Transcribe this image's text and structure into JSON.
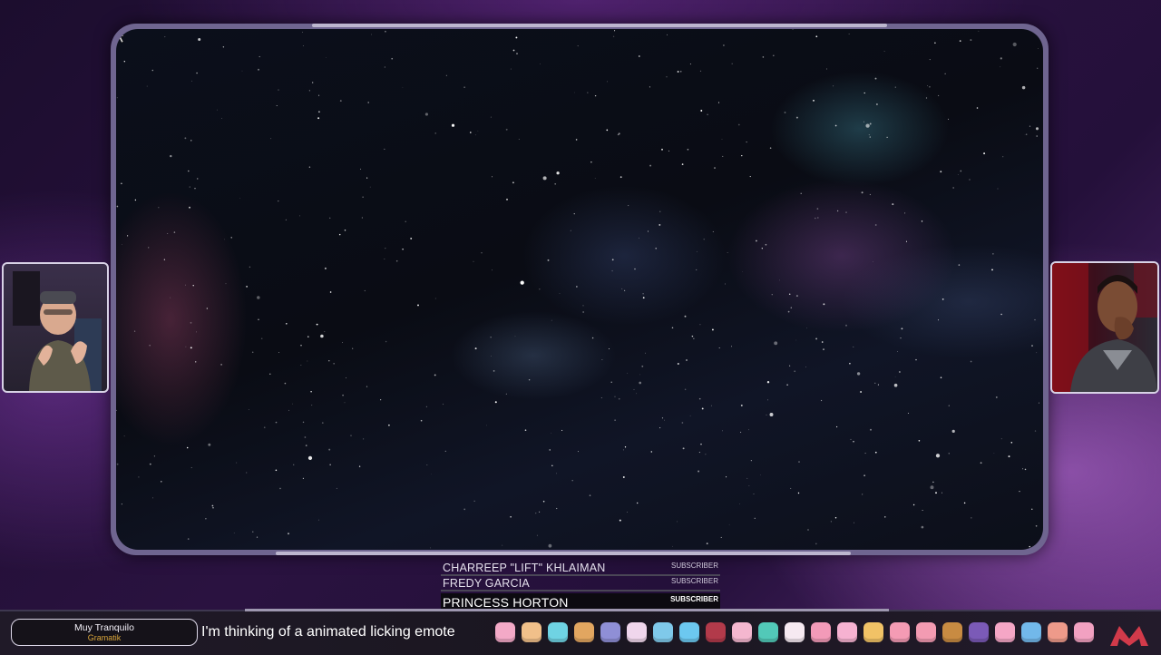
{
  "scene": {
    "name": "space-background"
  },
  "webcams": {
    "left": {
      "icon": "person-webcam-icon"
    },
    "right": {
      "icon": "person-webcam-icon"
    }
  },
  "subscribers": [
    {
      "name": "CHARREEP \"LIFT\" KHLAIMAN",
      "tag": "SUBSCRIBER"
    },
    {
      "name": "FREDY GARCIA",
      "tag": "SUBSCRIBER"
    },
    {
      "name": "PRINCESS HORTON",
      "tag": "SUBSCRIBER"
    }
  ],
  "now_playing": {
    "song": "Muy Tranquilo",
    "artist": "Gramatik"
  },
  "chat": {
    "message": "I'm thinking of a animated licking emote"
  },
  "emotes": [
    {
      "color": "#f3a9c7",
      "icon": "pink-emote-icon"
    },
    {
      "color": "#f1c08a",
      "icon": "cat-emote-icon"
    },
    {
      "color": "#6fd3e3",
      "icon": "blue-emote-icon"
    },
    {
      "color": "#e2a660",
      "icon": "hand-emote-icon"
    },
    {
      "color": "#8f8fd6",
      "icon": "face-emote-icon"
    },
    {
      "color": "#f0d6ec",
      "icon": "bunny-emote-icon"
    },
    {
      "color": "#7fc9ea",
      "icon": "bunny-blue-emote-icon"
    },
    {
      "color": "#6cc8f0",
      "icon": "blob-emote-icon"
    },
    {
      "color": "#b23a4a",
      "icon": "red-emote-icon"
    },
    {
      "color": "#f4b7cf",
      "icon": "pink-face-emote-icon"
    },
    {
      "color": "#52c9b8",
      "icon": "teal-emote-icon"
    },
    {
      "color": "#f6e9f1",
      "icon": "white-emote-icon"
    },
    {
      "color": "#f39ab8",
      "icon": "pink-cat-emote-icon"
    },
    {
      "color": "#f6b2d1",
      "icon": "bow-emote-icon"
    },
    {
      "color": "#f1c266",
      "icon": "fox-emote-icon"
    },
    {
      "color": "#f49bb4",
      "icon": "heart-emote-icon"
    },
    {
      "color": "#f39bb2",
      "icon": "kitty-emote-icon"
    },
    {
      "color": "#c88b42",
      "icon": "dog-emote-icon"
    },
    {
      "color": "#7b5ab7",
      "icon": "purple-emote-icon"
    },
    {
      "color": "#f5a6c6",
      "icon": "pink-bunny-emote-icon"
    },
    {
      "color": "#72b8ea",
      "icon": "blue-face-emote-icon"
    },
    {
      "color": "#ee9a8a",
      "icon": "peach-emote-icon"
    },
    {
      "color": "#f2a1c1",
      "icon": "rose-emote-icon"
    }
  ],
  "logo": {
    "icon": "channel-logo-icon",
    "color": "#d23a4a"
  }
}
